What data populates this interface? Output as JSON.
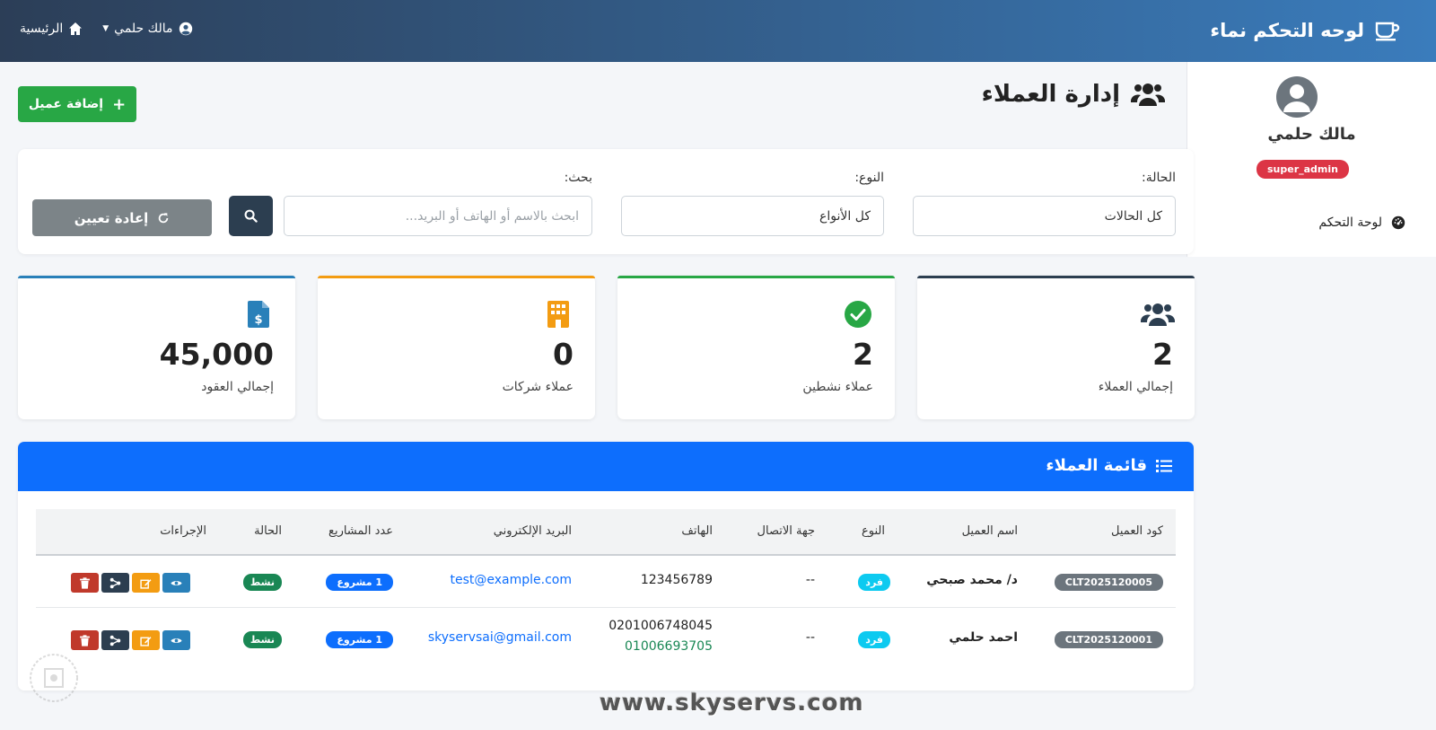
{
  "navbar": {
    "brand": "لوحه التحكم نماء",
    "home_label": "الرئيسية",
    "user_label": "مالك حلمي"
  },
  "sidebar": {
    "user_name": "مالك حلمي",
    "role": "super_admin",
    "links": [
      {
        "label": "لوحة التحكم",
        "icon": "dashboard-icon"
      }
    ]
  },
  "page": {
    "title": "إدارة العملاء",
    "add_button": "إضافة عميل"
  },
  "filters": {
    "status_label": "الحالة:",
    "status_value": "كل الحالات",
    "type_label": "النوع:",
    "type_value": "كل الأنواع",
    "search_label": "بحث:",
    "search_placeholder": "ابحث بالاسم أو الهاتف أو البريد...",
    "reset_button": "إعادة تعيين"
  },
  "stats": [
    {
      "value": "2",
      "label": "إجمالي العملاء",
      "icon": "users-icon",
      "color": "#2c3e50"
    },
    {
      "value": "2",
      "label": "عملاء نشطين",
      "icon": "check-circle-icon",
      "color": "#28a745"
    },
    {
      "value": "0",
      "label": "عملاء شركات",
      "icon": "building-icon",
      "color": "#f39c12"
    },
    {
      "value": "45,000",
      "label": "إجمالي العقود",
      "icon": "invoice-dollar-icon",
      "color": "#2980b9"
    }
  ],
  "clients_list": {
    "title": "قائمة العملاء",
    "columns": [
      "كود العميل",
      "اسم العميل",
      "النوع",
      "جهة الاتصال",
      "الهاتف",
      "البريد الإلكتروني",
      "عدد المشاريع",
      "الحالة",
      "الإجراءات"
    ],
    "rows": [
      {
        "code": "CLT2025120005",
        "name": "د/ محمد صبحي",
        "type": "فرد",
        "contact": "--",
        "phone": "123456789",
        "phone2": "",
        "email": "test@example.com",
        "projects": "1 مشروع",
        "status": "نشط"
      },
      {
        "code": "CLT2025120001",
        "name": "احمد حلمي",
        "type": "فرد",
        "contact": "--",
        "phone": "0201006748045",
        "phone2": "01006693705",
        "email": "skyservsai@gmail.com",
        "projects": "1 مشروع",
        "status": "نشط"
      }
    ]
  },
  "watermark": "www.skyservs.com",
  "colors": {
    "primary": "#0d6efd",
    "success": "#28a745",
    "danger": "#dc3545",
    "warning": "#f39c12",
    "dark": "#2c3e50"
  }
}
